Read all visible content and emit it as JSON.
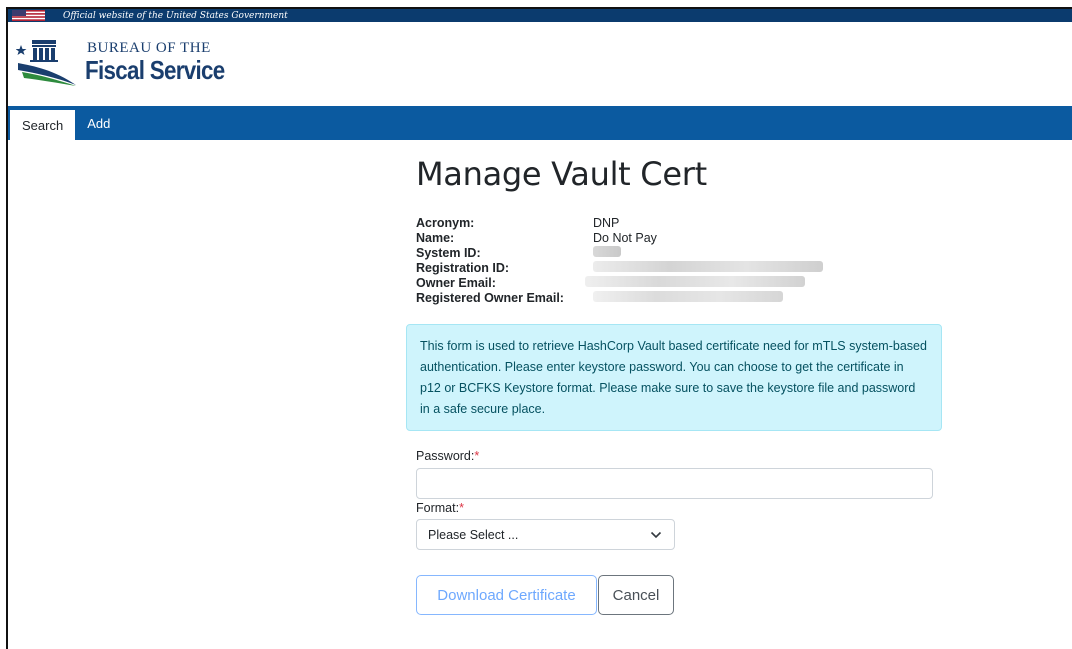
{
  "banner": {
    "text": "Official website of the United States Government"
  },
  "logo": {
    "line1": "BUREAU OF THE",
    "line2": "Fiscal Service"
  },
  "nav": {
    "tabs": [
      {
        "label": "Search",
        "active": true
      },
      {
        "label": "Add",
        "active": false
      }
    ]
  },
  "page": {
    "title": "Manage Vault Cert"
  },
  "info": [
    {
      "label": "Acronym:",
      "value": "DNP"
    },
    {
      "label": "Name:",
      "value": "Do Not Pay"
    },
    {
      "label": "System ID:",
      "value": ""
    },
    {
      "label": "Registration ID:",
      "value": ""
    },
    {
      "label": "Owner Email:",
      "value": ""
    },
    {
      "label": "Registered Owner Email:",
      "value": ""
    }
  ],
  "alert": {
    "text": "This form is used to retrieve HashCorp Vault based certificate need for mTLS system-based authentication. Please enter keystore password. You can choose to get the certificate in p12 or BCFKS Keystore format. Please make sure to save the keystore file and password in a safe secure place."
  },
  "form": {
    "password_label": "Password:",
    "format_label": "Format:",
    "required_marker": "*",
    "password_value": "",
    "format_selected": "Please Select ..."
  },
  "buttons": {
    "download": "Download Certificate",
    "cancel": "Cancel"
  },
  "colors": {
    "banner": "#0b3b6e",
    "navbar": "#0b5aa0",
    "alert_bg": "#cff4fc",
    "alert_text": "#055160",
    "required": "#dc3545",
    "brand": "#1a3e6e"
  },
  "icons": {
    "flag": "us-flag-icon",
    "logo": "treasury-building-icon",
    "select": "chevron-down-icon"
  }
}
